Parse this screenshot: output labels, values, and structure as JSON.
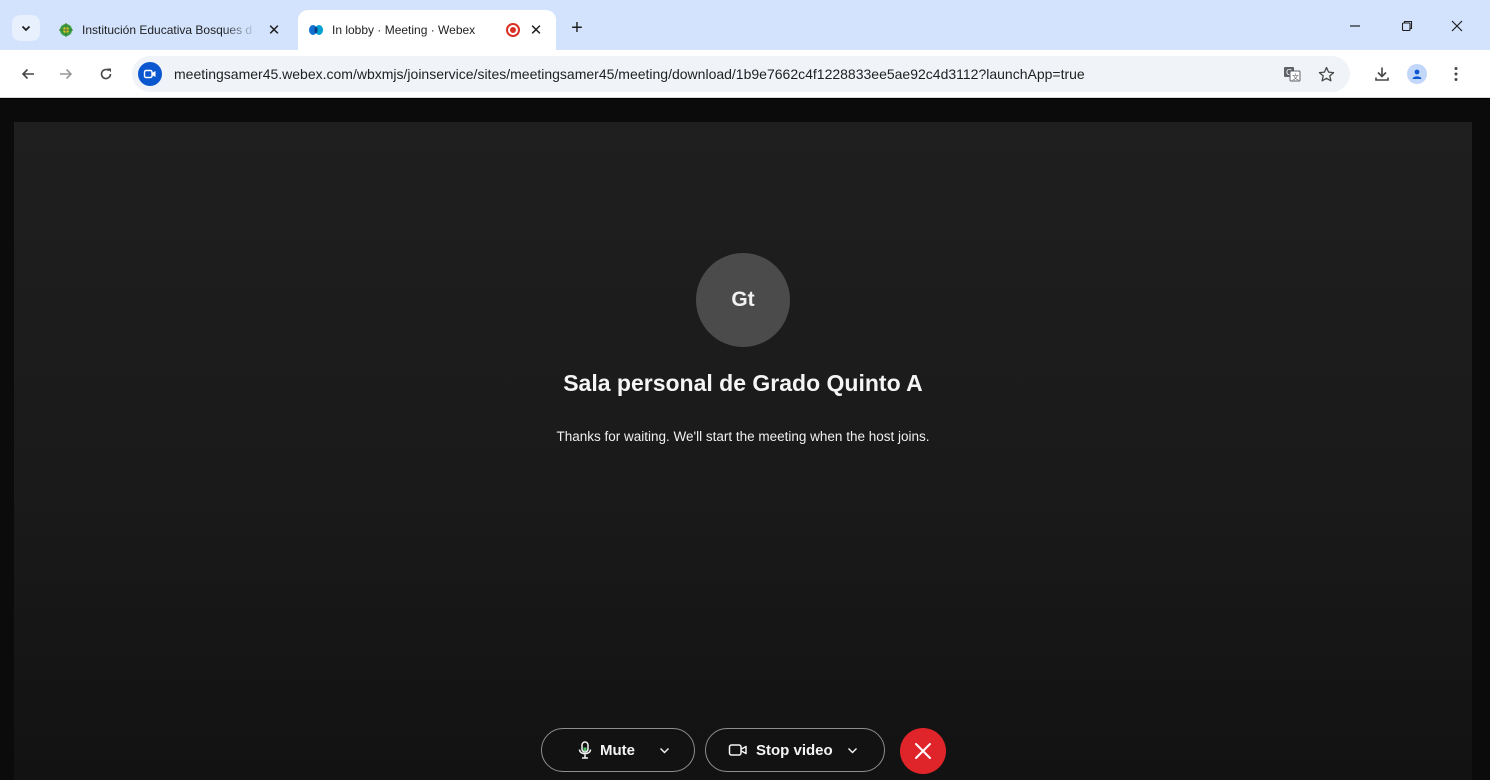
{
  "browser": {
    "tab_search_icon": "chevron-down-icon",
    "tabs": [
      {
        "title": "Institución Educativa Bosques d",
        "favicon": "school-crest-icon",
        "active": false
      },
      {
        "title": "In lobby · Meeting · Webex",
        "favicon": "webex-icon",
        "active": true,
        "recording": true
      }
    ],
    "new_tab_label": "+",
    "address_bar": {
      "url": "meetingsamer45.webex.com/wbxmjs/joinservice/sites/meetingsamer45/meeting/download/1b9e7662c4f1228833ee5ae92c4d3112?launchApp=true"
    }
  },
  "meeting": {
    "avatar_initials": "Gt",
    "room_title": "Sala personal de Grado Quinto A",
    "lobby_message": "Thanks for waiting. We'll start the meeting when the host joins.",
    "controls": {
      "mute_label": "Mute",
      "stop_video_label": "Stop video"
    }
  },
  "colors": {
    "tabstrip": "#d3e3fd",
    "stage": "#1c1c1c",
    "leave": "#e0252a",
    "avatar": "#4b4b4b"
  }
}
